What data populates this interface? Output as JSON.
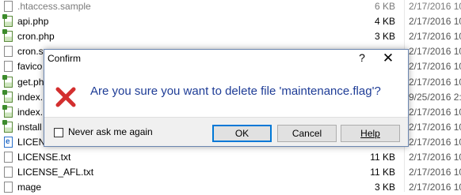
{
  "files": [
    {
      "name": ".htaccess.sample",
      "size": "6 KB",
      "date": "2/17/2016 10",
      "icon": "file-icon",
      "dim": true
    },
    {
      "name": "api.php",
      "size": "4 KB",
      "date": "2/17/2016 10",
      "icon": "php-file-icon"
    },
    {
      "name": "cron.php",
      "size": "3 KB",
      "date": "2/17/2016 10",
      "icon": "php-file-icon"
    },
    {
      "name": "cron.s",
      "size": "",
      "date": "2/17/2016 10",
      "icon": "file-icon"
    },
    {
      "name": "favico",
      "size": "",
      "date": "2/17/2016 10",
      "icon": "file-icon"
    },
    {
      "name": "get.ph",
      "size": "",
      "date": "2/17/2016 10",
      "icon": "php-file-icon"
    },
    {
      "name": "index.",
      "size": "",
      "date": "9/25/2016 2:5",
      "icon": "php-file-icon"
    },
    {
      "name": "index.",
      "size": "",
      "date": "2/17/2016 10",
      "icon": "php-file-icon"
    },
    {
      "name": "install",
      "size": "",
      "date": "2/17/2016 10",
      "icon": "php-file-icon"
    },
    {
      "name": "LICENS",
      "size": "",
      "date": "2/17/2016 10",
      "icon": "html-file-icon"
    },
    {
      "name": "LICENSE.txt",
      "size": "11 KB",
      "date": "2/17/2016 10",
      "icon": "file-icon"
    },
    {
      "name": "LICENSE_AFL.txt",
      "size": "11 KB",
      "date": "2/17/2016 10",
      "icon": "file-icon"
    },
    {
      "name": "mage",
      "size": "3 KB",
      "date": "2/17/2016 10",
      "icon": "file-icon"
    }
  ],
  "dialog": {
    "title": "Confirm",
    "help_glyph": "?",
    "close_glyph": "✕",
    "message": "Are you sure you want to delete file 'maintenance.flag'?",
    "icon": "error-x-icon",
    "checkbox_label": "Never ask me again",
    "checkbox_checked": false,
    "ok_label": "OK",
    "cancel_label": "Cancel",
    "help_label": "Help"
  },
  "colors": {
    "message_text": "#1e3c96",
    "error_icon": "#d32f2f",
    "dialog_border": "#6b86b0",
    "default_button_border": "#0078d7"
  }
}
